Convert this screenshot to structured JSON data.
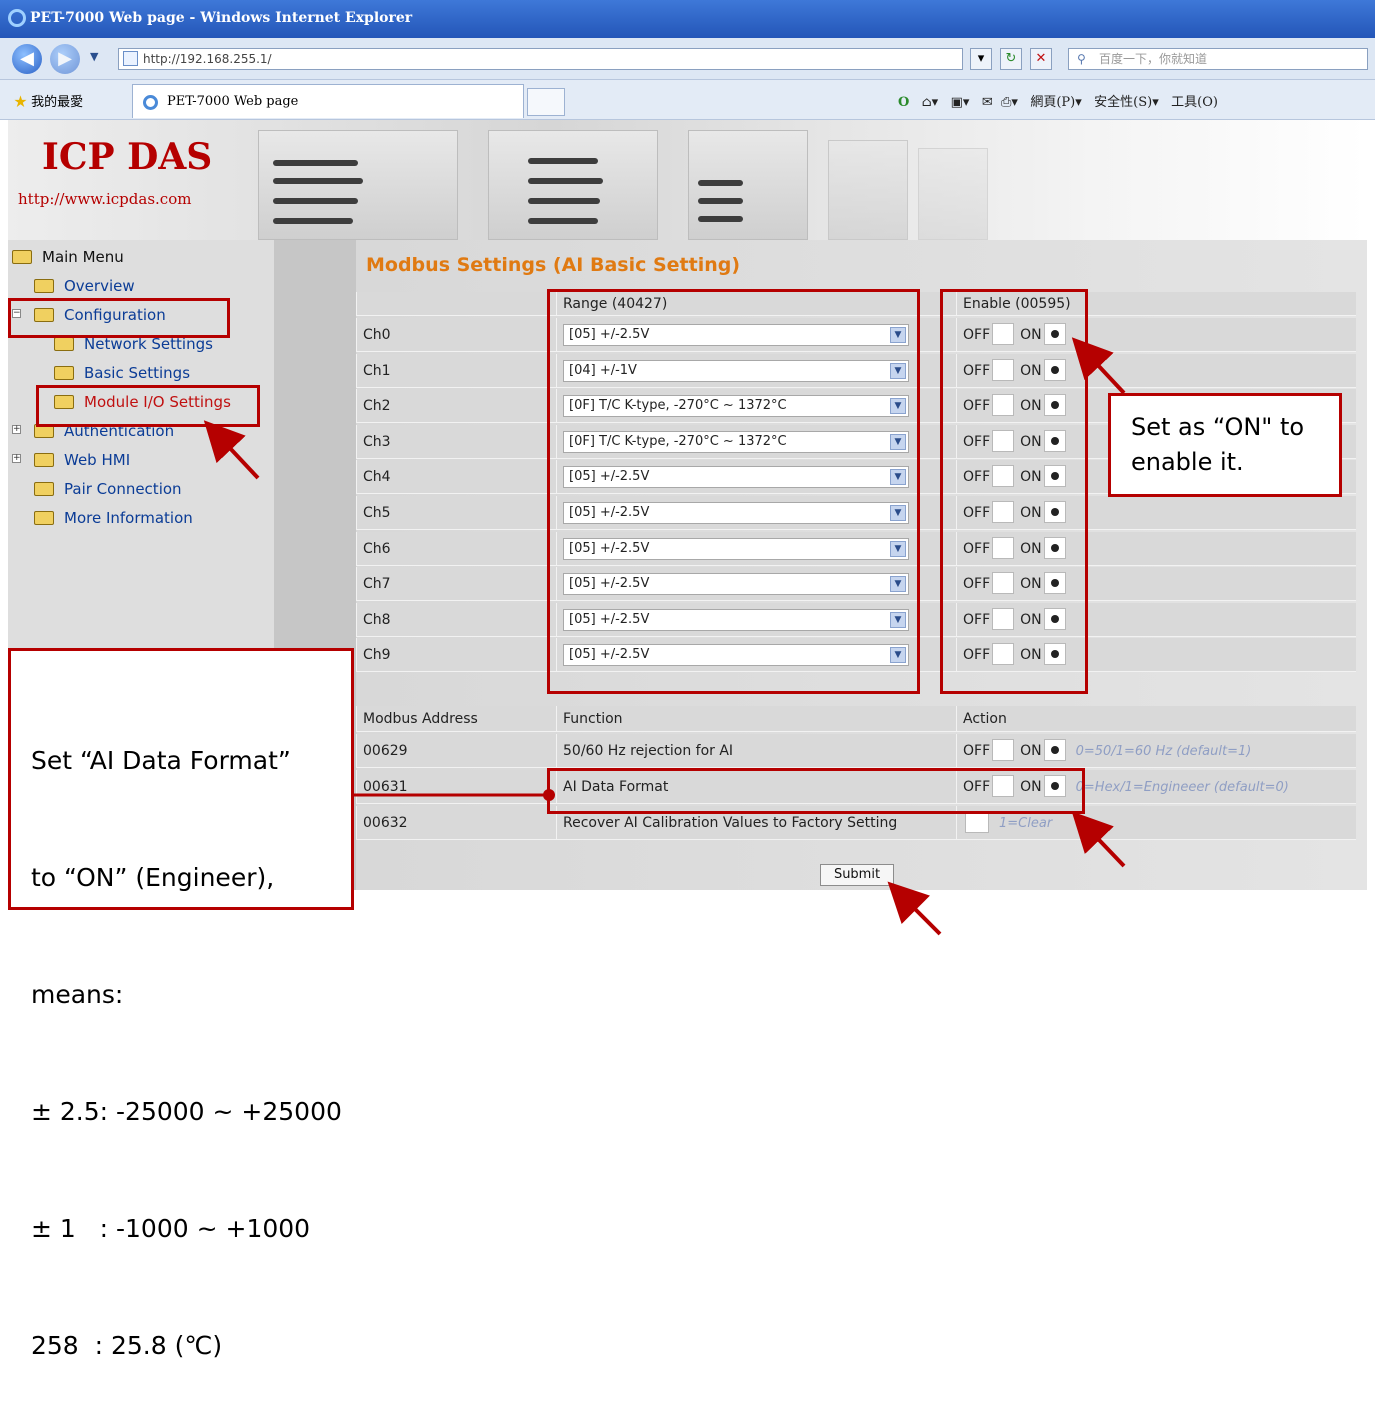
{
  "window": {
    "title": "PET-7000 Web page - Windows Internet Explorer"
  },
  "browser": {
    "address": "http://192.168.255.1/",
    "search_placeholder": "百度一下，你就知道",
    "favorites_label": "我的最愛",
    "tab_title": "PET-7000 Web page",
    "page_menu": "網頁(P)",
    "safety_menu": "安全性(S)",
    "tools_menu": "工具(O)"
  },
  "banner": {
    "logo": "ICP DAS",
    "url": "http://www.icpdas.com"
  },
  "sidebar": {
    "root": "Main Menu",
    "items": [
      "Overview",
      "Configuration",
      "Network Settings",
      "Basic Settings",
      "Module I/O Settings",
      "Authentication",
      "Web HMI",
      "Pair Connection",
      "More Information"
    ]
  },
  "main": {
    "heading": "Modbus Settings (AI Basic Setting)",
    "range_header": "Range (40427)",
    "enable_header": "Enable (00595)",
    "channels": [
      {
        "name": "Ch0",
        "range": "[05] +/-2.5V",
        "enabled": true
      },
      {
        "name": "Ch1",
        "range": "[04] +/-1V",
        "enabled": true
      },
      {
        "name": "Ch2",
        "range": "[0F] T/C K-type, -270°C ~ 1372°C",
        "enabled": true
      },
      {
        "name": "Ch3",
        "range": "[0F] T/C K-type, -270°C ~ 1372°C",
        "enabled": true
      },
      {
        "name": "Ch4",
        "range": "[05] +/-2.5V",
        "enabled": true
      },
      {
        "name": "Ch5",
        "range": "[05] +/-2.5V",
        "enabled": true
      },
      {
        "name": "Ch6",
        "range": "[05] +/-2.5V",
        "enabled": true
      },
      {
        "name": "Ch7",
        "range": "[05] +/-2.5V",
        "enabled": true
      },
      {
        "name": "Ch8",
        "range": "[05] +/-2.5V",
        "enabled": true
      },
      {
        "name": "Ch9",
        "range": "[05] +/-2.5V",
        "enabled": true
      }
    ],
    "off_label": "OFF",
    "on_label": "ON",
    "func_headers": {
      "address": "Modbus Address",
      "function": "Function",
      "action": "Action"
    },
    "functions": [
      {
        "address": "00629",
        "function": "50/60 Hz rejection for AI",
        "hint": "0=50/1=60 Hz (default=1)"
      },
      {
        "address": "00631",
        "function": "AI Data Format",
        "hint": "0=Hex/1=Engineeer (default=0)"
      },
      {
        "address": "00632",
        "function": "Recover AI Calibration Values to Factory Setting",
        "hint": "1=Clear"
      }
    ],
    "submit": "Submit"
  },
  "annotations": {
    "enable_note": [
      "Set as “ON\" to",
      "enable it."
    ],
    "format_note": [
      "Set “AI Data Format”",
      "to “ON” (Engineer),",
      "means:",
      "± 2.5: -25000 ~ +25000",
      "± 1   : -1000 ~ +1000",
      "258  : 25.8 (℃)"
    ]
  },
  "colors": {
    "heading": "#e07a12",
    "annotation_red": "#b50000",
    "link_blue": "#0b3c96"
  }
}
